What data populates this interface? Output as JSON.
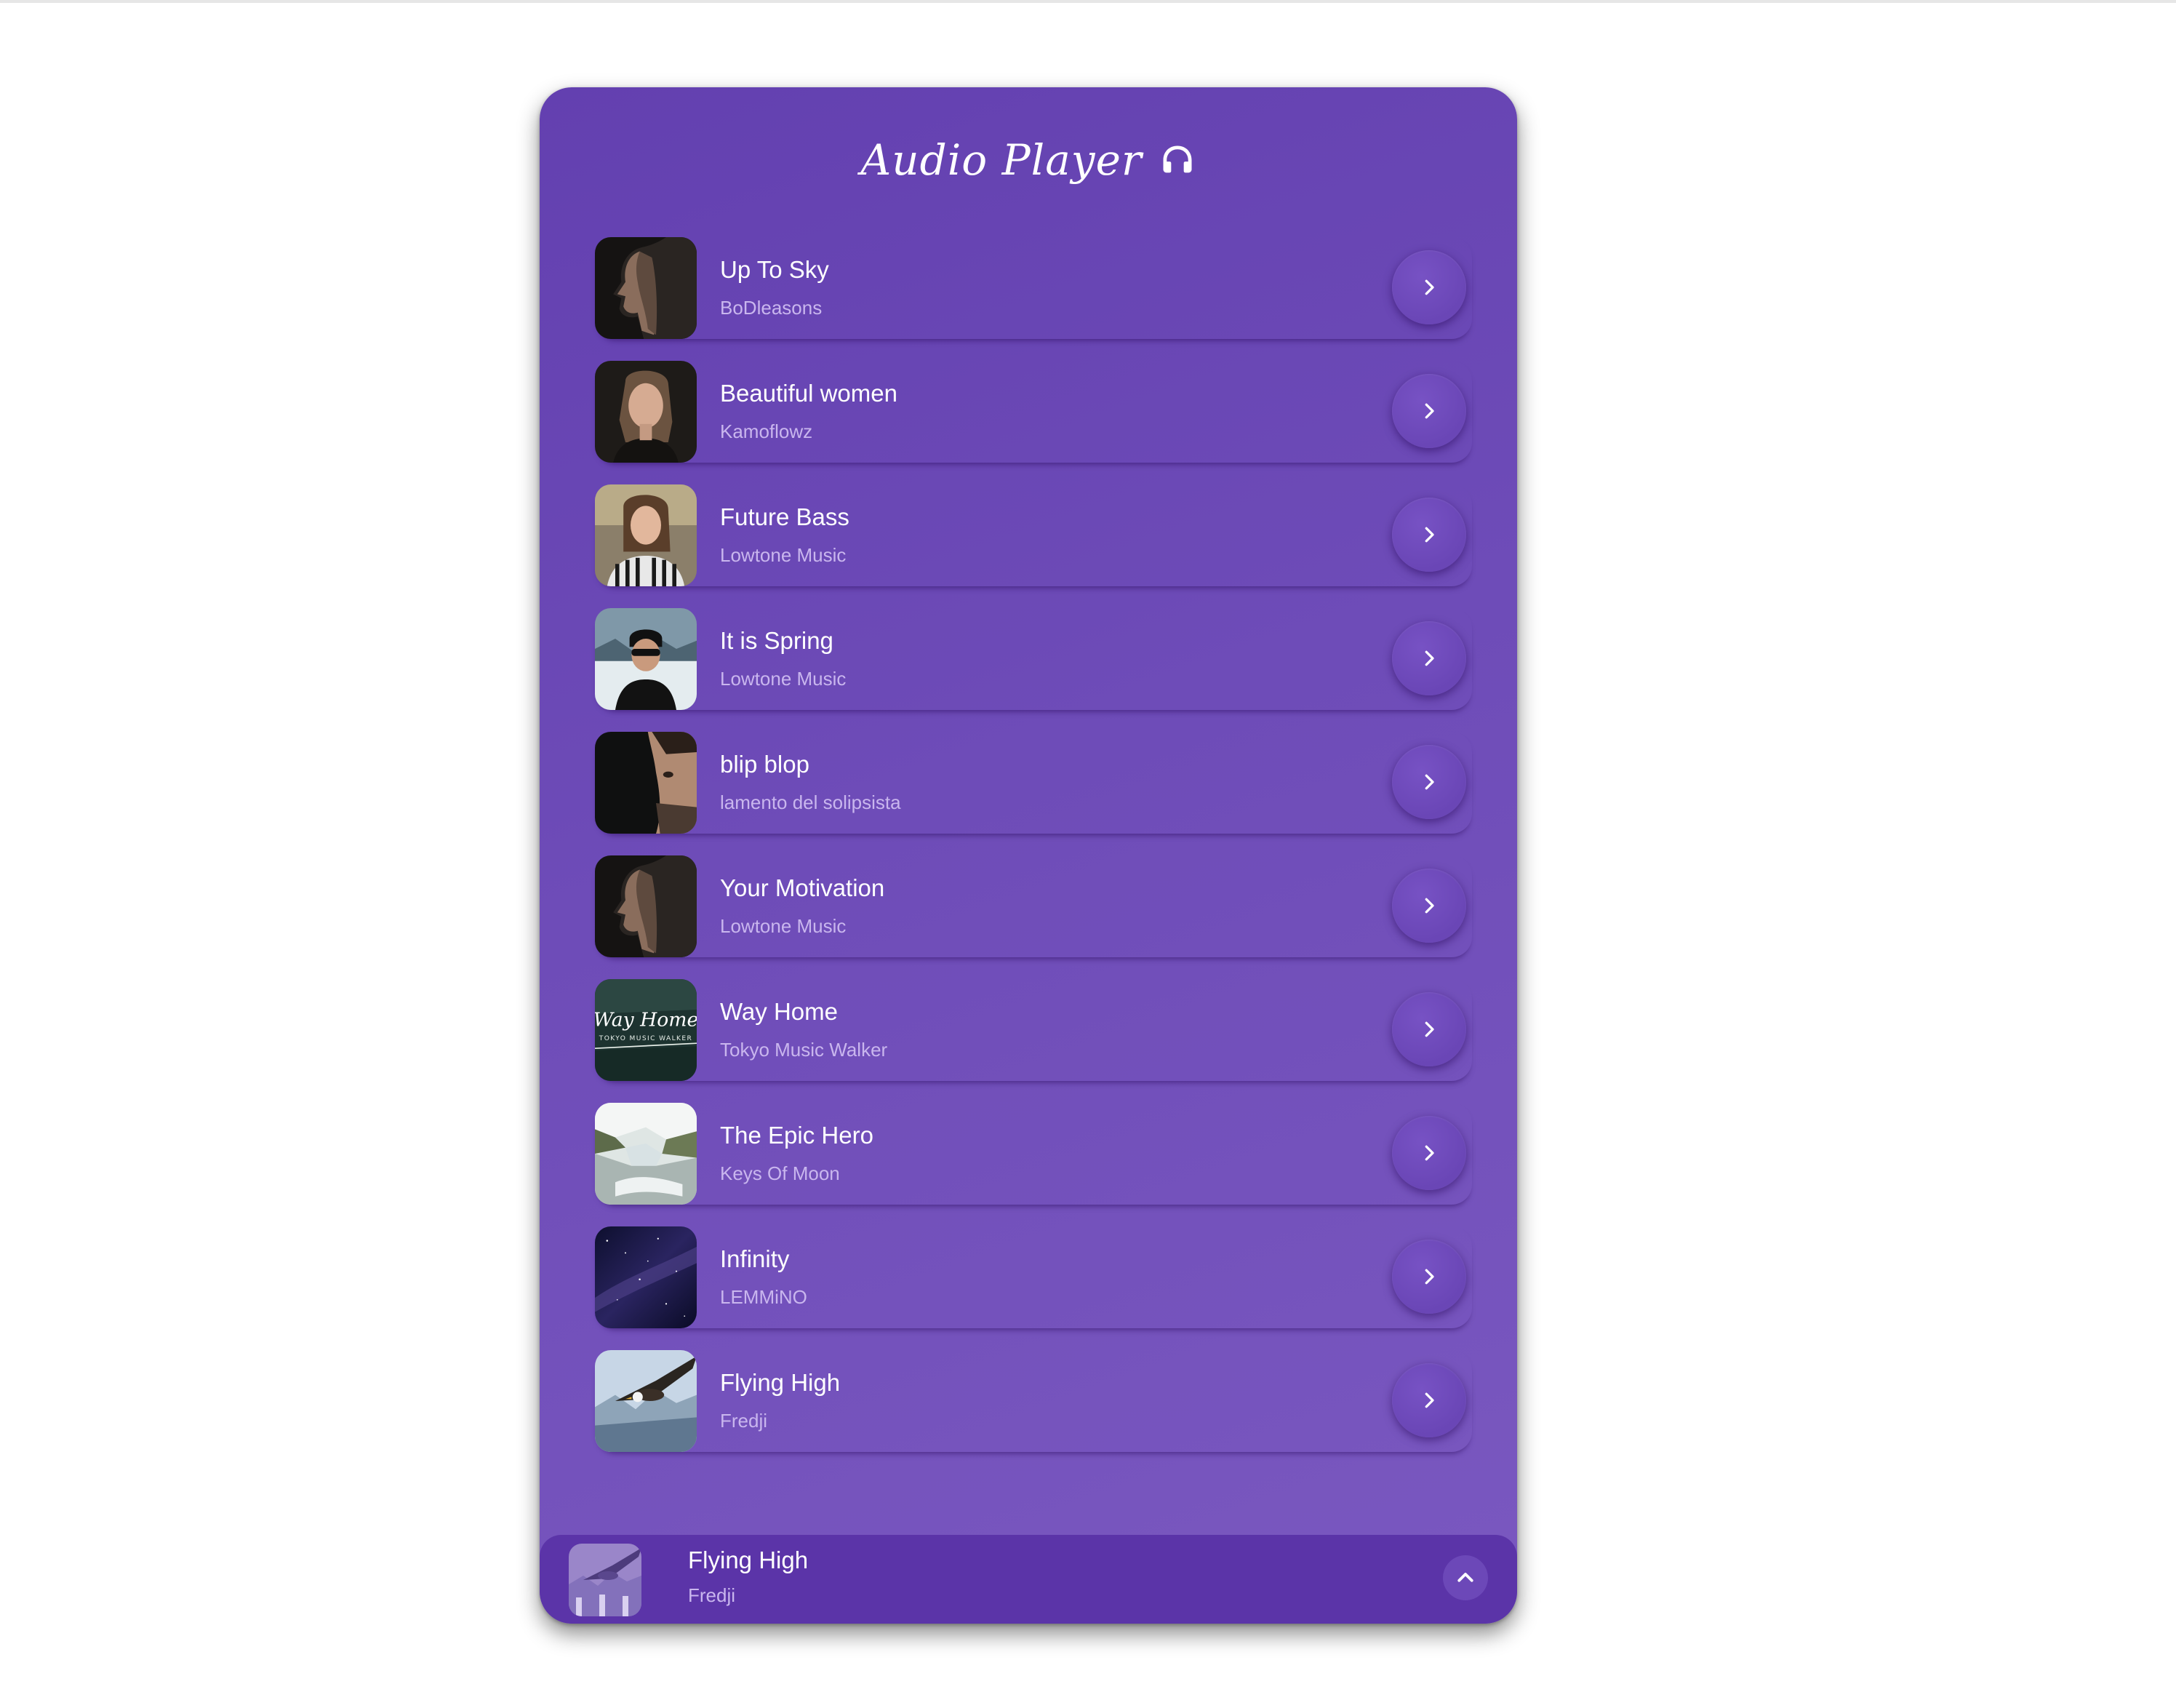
{
  "header": {
    "title": "Audio Player",
    "icon": "headphones-icon"
  },
  "colors": {
    "panel": "#6a47b6",
    "now_bar": "#5b34a8",
    "text": "#ffffff",
    "subtext": "#c9b6ee"
  },
  "tracks": [
    {
      "title": "Up To Sky",
      "artist": "BoDleasons",
      "cover": "man-profile-dark"
    },
    {
      "title": "Beautiful women",
      "artist": "Kamoflowz",
      "cover": "woman-portrait"
    },
    {
      "title": "Future Bass",
      "artist": "Lowtone Music",
      "cover": "woman-striped-shirt"
    },
    {
      "title": "It is Spring",
      "artist": "Lowtone Music",
      "cover": "man-beanie-snow"
    },
    {
      "title": "blip blop",
      "artist": "lamento del solipsista",
      "cover": "half-face"
    },
    {
      "title": "Your Motivation",
      "artist": "Lowtone Music",
      "cover": "man-profile-dark"
    },
    {
      "title": "Way Home",
      "artist": "Tokyo Music Walker",
      "cover": "way-home-forest",
      "cover_text": "Way Home",
      "cover_subtext": "TOKYO MUSIC WALKER"
    },
    {
      "title": "The Epic Hero",
      "artist": "Keys Of Moon",
      "cover": "waterfall"
    },
    {
      "title": "Infinity",
      "artist": "LEMMiNO",
      "cover": "night-sky"
    },
    {
      "title": "Flying High",
      "artist": "Fredji",
      "cover": "eagle"
    }
  ],
  "now_playing": {
    "title": "Flying High",
    "artist": "Fredji",
    "cover": "eagle",
    "expand_icon": "chevron-up-icon"
  },
  "row_icon": "chevron-right-icon"
}
